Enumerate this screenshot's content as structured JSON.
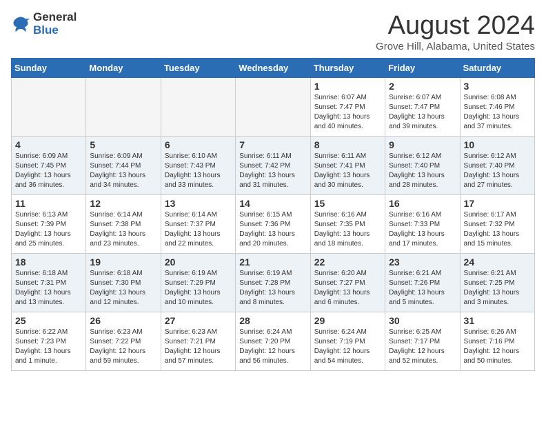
{
  "header": {
    "logo_general": "General",
    "logo_blue": "Blue",
    "title": "August 2024",
    "location": "Grove Hill, Alabama, United States"
  },
  "days_of_week": [
    "Sunday",
    "Monday",
    "Tuesday",
    "Wednesday",
    "Thursday",
    "Friday",
    "Saturday"
  ],
  "weeks": [
    [
      {
        "day": "",
        "empty": true
      },
      {
        "day": "",
        "empty": true
      },
      {
        "day": "",
        "empty": true
      },
      {
        "day": "",
        "empty": true
      },
      {
        "day": "1",
        "sunrise": "6:07 AM",
        "sunset": "7:47 PM",
        "daylight": "13 hours and 40 minutes."
      },
      {
        "day": "2",
        "sunrise": "6:07 AM",
        "sunset": "7:47 PM",
        "daylight": "13 hours and 39 minutes."
      },
      {
        "day": "3",
        "sunrise": "6:08 AM",
        "sunset": "7:46 PM",
        "daylight": "13 hours and 37 minutes."
      }
    ],
    [
      {
        "day": "4",
        "sunrise": "6:09 AM",
        "sunset": "7:45 PM",
        "daylight": "13 hours and 36 minutes."
      },
      {
        "day": "5",
        "sunrise": "6:09 AM",
        "sunset": "7:44 PM",
        "daylight": "13 hours and 34 minutes."
      },
      {
        "day": "6",
        "sunrise": "6:10 AM",
        "sunset": "7:43 PM",
        "daylight": "13 hours and 33 minutes."
      },
      {
        "day": "7",
        "sunrise": "6:11 AM",
        "sunset": "7:42 PM",
        "daylight": "13 hours and 31 minutes."
      },
      {
        "day": "8",
        "sunrise": "6:11 AM",
        "sunset": "7:41 PM",
        "daylight": "13 hours and 30 minutes."
      },
      {
        "day": "9",
        "sunrise": "6:12 AM",
        "sunset": "7:40 PM",
        "daylight": "13 hours and 28 minutes."
      },
      {
        "day": "10",
        "sunrise": "6:12 AM",
        "sunset": "7:40 PM",
        "daylight": "13 hours and 27 minutes."
      }
    ],
    [
      {
        "day": "11",
        "sunrise": "6:13 AM",
        "sunset": "7:39 PM",
        "daylight": "13 hours and 25 minutes."
      },
      {
        "day": "12",
        "sunrise": "6:14 AM",
        "sunset": "7:38 PM",
        "daylight": "13 hours and 23 minutes."
      },
      {
        "day": "13",
        "sunrise": "6:14 AM",
        "sunset": "7:37 PM",
        "daylight": "13 hours and 22 minutes."
      },
      {
        "day": "14",
        "sunrise": "6:15 AM",
        "sunset": "7:36 PM",
        "daylight": "13 hours and 20 minutes."
      },
      {
        "day": "15",
        "sunrise": "6:16 AM",
        "sunset": "7:35 PM",
        "daylight": "13 hours and 18 minutes."
      },
      {
        "day": "16",
        "sunrise": "6:16 AM",
        "sunset": "7:33 PM",
        "daylight": "13 hours and 17 minutes."
      },
      {
        "day": "17",
        "sunrise": "6:17 AM",
        "sunset": "7:32 PM",
        "daylight": "13 hours and 15 minutes."
      }
    ],
    [
      {
        "day": "18",
        "sunrise": "6:18 AM",
        "sunset": "7:31 PM",
        "daylight": "13 hours and 13 minutes."
      },
      {
        "day": "19",
        "sunrise": "6:18 AM",
        "sunset": "7:30 PM",
        "daylight": "13 hours and 12 minutes."
      },
      {
        "day": "20",
        "sunrise": "6:19 AM",
        "sunset": "7:29 PM",
        "daylight": "13 hours and 10 minutes."
      },
      {
        "day": "21",
        "sunrise": "6:19 AM",
        "sunset": "7:28 PM",
        "daylight": "13 hours and 8 minutes."
      },
      {
        "day": "22",
        "sunrise": "6:20 AM",
        "sunset": "7:27 PM",
        "daylight": "13 hours and 6 minutes."
      },
      {
        "day": "23",
        "sunrise": "6:21 AM",
        "sunset": "7:26 PM",
        "daylight": "13 hours and 5 minutes."
      },
      {
        "day": "24",
        "sunrise": "6:21 AM",
        "sunset": "7:25 PM",
        "daylight": "13 hours and 3 minutes."
      }
    ],
    [
      {
        "day": "25",
        "sunrise": "6:22 AM",
        "sunset": "7:23 PM",
        "daylight": "13 hours and 1 minute."
      },
      {
        "day": "26",
        "sunrise": "6:23 AM",
        "sunset": "7:22 PM",
        "daylight": "12 hours and 59 minutes."
      },
      {
        "day": "27",
        "sunrise": "6:23 AM",
        "sunset": "7:21 PM",
        "daylight": "12 hours and 57 minutes."
      },
      {
        "day": "28",
        "sunrise": "6:24 AM",
        "sunset": "7:20 PM",
        "daylight": "12 hours and 56 minutes."
      },
      {
        "day": "29",
        "sunrise": "6:24 AM",
        "sunset": "7:19 PM",
        "daylight": "12 hours and 54 minutes."
      },
      {
        "day": "30",
        "sunrise": "6:25 AM",
        "sunset": "7:17 PM",
        "daylight": "12 hours and 52 minutes."
      },
      {
        "day": "31",
        "sunrise": "6:26 AM",
        "sunset": "7:16 PM",
        "daylight": "12 hours and 50 minutes."
      }
    ]
  ]
}
